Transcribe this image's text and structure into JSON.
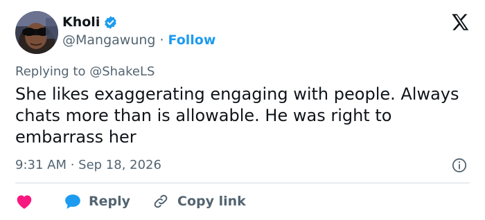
{
  "author": {
    "name": "Kholi",
    "handle": "@Mangawung",
    "separator": "·",
    "follow_label": "Follow",
    "verified": true
  },
  "reply_to": {
    "prefix": "Replying to",
    "mention": "@ShakeLS"
  },
  "tweet": {
    "text": "She likes exaggerating engaging with people. Always chats more than is allowable. He was right to embarrass her",
    "timestamp": "9:31 AM · Sep 18, 2026"
  },
  "actions": {
    "like_icon": "heart-icon",
    "reply_label": "Reply",
    "copy_link_label": "Copy link"
  },
  "colors": {
    "accent": "#1d9bf0",
    "like": "#f91880",
    "muted": "#536471",
    "text": "#0f1419"
  }
}
